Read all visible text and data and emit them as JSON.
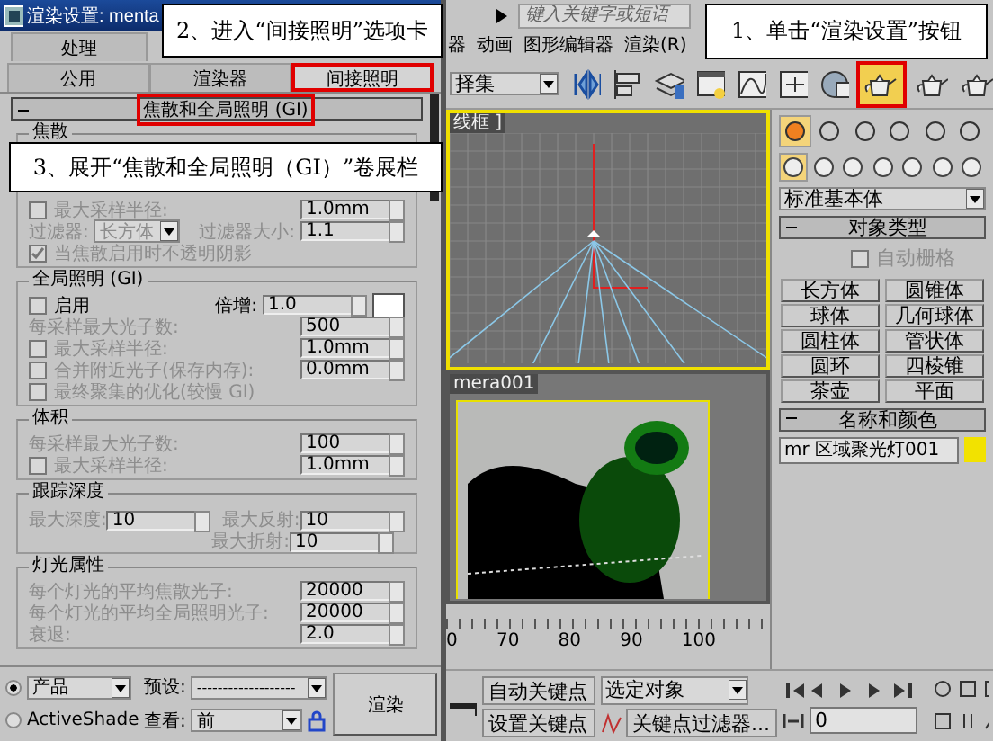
{
  "dialog": {
    "title": "渲染设置: menta",
    "tabs_row_1": [
      {
        "label": "处理",
        "selected": false,
        "highlighted": false
      }
    ],
    "tabs_row_2": [
      {
        "label": "公用",
        "selected": false,
        "highlighted": false
      },
      {
        "label": "渲染器",
        "selected": false,
        "highlighted": false
      },
      {
        "label": "间接照明",
        "selected": true,
        "highlighted": true
      }
    ],
    "rollout": {
      "title": "焦散和全局照明 (GI)",
      "expanded": true,
      "highlighted": true
    },
    "groups": [
      {
        "title": "焦散",
        "rows": [
          {
            "kind": "flex",
            "disabled": true,
            "cells": [
              {
                "kind": "checkbox",
                "label": "最大采样半径:",
                "checked": false
              },
              "",
              "",
              {
                "kind": "spinner",
                "value": "1.0mm"
              }
            ]
          },
          {
            "kind": "flex",
            "disabled": true,
            "cells": [
              {
                "kind": "label",
                "text": "过滤器:"
              },
              {
                "kind": "dropdown",
                "value": "长方体"
              },
              {
                "kind": "label",
                "text": "过滤器大小:"
              },
              {
                "kind": "spinner",
                "value": "1.1"
              }
            ]
          },
          {
            "kind": "flex",
            "disabled": true,
            "cells": [
              {
                "kind": "checkbox",
                "label": "当焦散启用时不透明阴影",
                "checked": true
              }
            ]
          }
        ]
      },
      {
        "title": "全局照明 (GI)",
        "rows": [
          {
            "kind": "flex",
            "disabled": false,
            "cells": [
              {
                "kind": "checkbox",
                "label": "启用",
                "checked": false
              },
              {
                "kind": "label",
                "text": "倍增:"
              },
              {
                "kind": "spinner",
                "value": "1.0"
              },
              {
                "kind": "swatch",
                "color": "#ffffff"
              }
            ]
          },
          {
            "kind": "flex",
            "disabled": true,
            "cells": [
              {
                "kind": "label",
                "text": "每采样最大光子数:"
              },
              {
                "kind": "spinner",
                "value": "500"
              }
            ]
          },
          {
            "kind": "flex",
            "disabled": true,
            "cells": [
              {
                "kind": "checkbox",
                "label": "最大采样半径:",
                "checked": false
              },
              {
                "kind": "spinner",
                "value": "1.0mm"
              }
            ]
          },
          {
            "kind": "flex",
            "disabled": true,
            "cells": [
              {
                "kind": "checkbox",
                "label": "合并附近光子(保存内存):",
                "checked": false
              },
              {
                "kind": "spinner",
                "value": "0.0mm"
              }
            ]
          },
          {
            "kind": "flex",
            "disabled": true,
            "cells": [
              {
                "kind": "checkbox",
                "label": "最终聚集的优化(较慢 GI)",
                "checked": false
              }
            ]
          }
        ]
      },
      {
        "title": "体积",
        "rows": [
          {
            "kind": "flex",
            "disabled": true,
            "cells": [
              {
                "kind": "label",
                "text": "每采样最大光子数:"
              },
              {
                "kind": "spinner",
                "value": "100"
              }
            ]
          },
          {
            "kind": "flex",
            "disabled": true,
            "cells": [
              {
                "kind": "checkbox",
                "label": "最大采样半径:",
                "checked": false
              },
              {
                "kind": "spinner",
                "value": "1.0mm"
              }
            ]
          }
        ]
      },
      {
        "title": "跟踪深度",
        "rows": [
          {
            "kind": "grid",
            "disabled": true,
            "cells": [
              {
                "kind": "label",
                "text": "最大深度:"
              },
              {
                "kind": "spinner",
                "value": "10"
              },
              {
                "kind": "label",
                "text": "最大反射:"
              },
              {
                "kind": "spinner",
                "value": "10"
              }
            ]
          },
          {
            "kind": "grid",
            "disabled": true,
            "cells": [
              "",
              "",
              {
                "kind": "label",
                "text": "最大折射:"
              },
              {
                "kind": "spinner",
                "value": "10"
              }
            ]
          }
        ]
      },
      {
        "title": "灯光属性",
        "rows": [
          {
            "kind": "flex",
            "disabled": true,
            "cells": [
              {
                "kind": "label",
                "text": "每个灯光的平均焦散光子:"
              },
              {
                "kind": "spinner",
                "value": "20000"
              }
            ]
          },
          {
            "kind": "flex",
            "disabled": true,
            "cells": [
              {
                "kind": "label",
                "text": "每个灯光的平均全局照明光子:"
              },
              {
                "kind": "spinner",
                "value": "20000"
              }
            ]
          },
          {
            "kind": "flex",
            "disabled": true,
            "cells": [
              {
                "kind": "label",
                "text": "衰退:"
              },
              {
                "kind": "spinner",
                "value": "2.0"
              }
            ]
          }
        ]
      }
    ],
    "render_target": [
      {
        "label": "产品",
        "selected": true
      },
      {
        "label": "ActiveShade",
        "selected": false
      }
    ],
    "preset": {
      "label": "预设:",
      "value": "-------------------"
    },
    "view": {
      "label": "查看:",
      "value": "前"
    },
    "render_button": "渲染"
  },
  "search": {
    "placeholder": "键入关键字或短语"
  },
  "menus": [
    "器",
    "动画",
    "图形编辑器",
    "渲染(R)"
  ],
  "toolbar": {
    "selection_set": "择集",
    "render_setup_highlighted": true
  },
  "viewports": [
    {
      "label": "线框 ]",
      "active": true
    },
    {
      "label": "mera001",
      "active": false
    }
  ],
  "command_panel": {
    "category": "标准基本体",
    "object_type": {
      "title": "对象类型",
      "expanded": true,
      "autogrid": {
        "label": "自动栅格",
        "checked": false
      },
      "buttons": [
        "长方体",
        "圆锥体",
        "球体",
        "几何球体",
        "圆柱体",
        "管状体",
        "圆环",
        "四棱锥",
        "茶壶",
        "平面"
      ]
    },
    "name_color": {
      "title": "名称和颜色",
      "expanded": true,
      "name": "mr 区域聚光灯001",
      "color": "#f2e200"
    }
  },
  "timeline": {
    "ticks": [
      "0",
      "70",
      "80",
      "90",
      "100"
    ]
  },
  "animation": {
    "auto_key": "自动关键点",
    "set_key": "设置关键点",
    "key_mode": "选定对象",
    "key_filters": "关键点过滤器...",
    "frame": "0"
  },
  "callouts": [
    {
      "text": "2、进入“间接照明”选项卡"
    },
    {
      "text": "3、展开“焦散和全局照明（GI）”卷展栏"
    },
    {
      "text": "1、单击“渲染设置”按钮"
    }
  ]
}
